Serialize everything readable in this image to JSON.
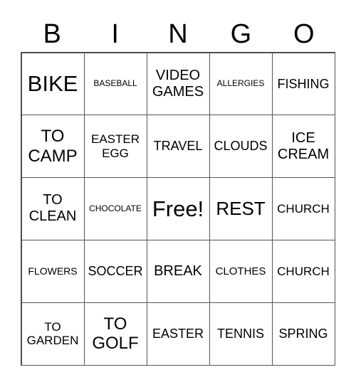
{
  "header": {
    "letters": [
      "B",
      "I",
      "N",
      "G",
      "O"
    ]
  },
  "cells": [
    [
      "BIKE",
      "BASEBALL",
      "VIDEO GAMES",
      "ALLERGIES",
      "FISHING"
    ],
    [
      "TO CAMP",
      "EASTER EGG",
      "TRAVEL",
      "CLOUDS",
      "ICE CREAM"
    ],
    [
      "TO CLEAN",
      "CHOCOLATE",
      "Free!",
      "REST",
      "CHURCH"
    ],
    [
      "FLOWERS",
      "SOCCER",
      "BREAK",
      "CLOTHES",
      "CHURCH"
    ],
    [
      "TO GARDEN",
      "TO GOLF",
      "EASTER",
      "TENNIS",
      "SPRING"
    ]
  ]
}
